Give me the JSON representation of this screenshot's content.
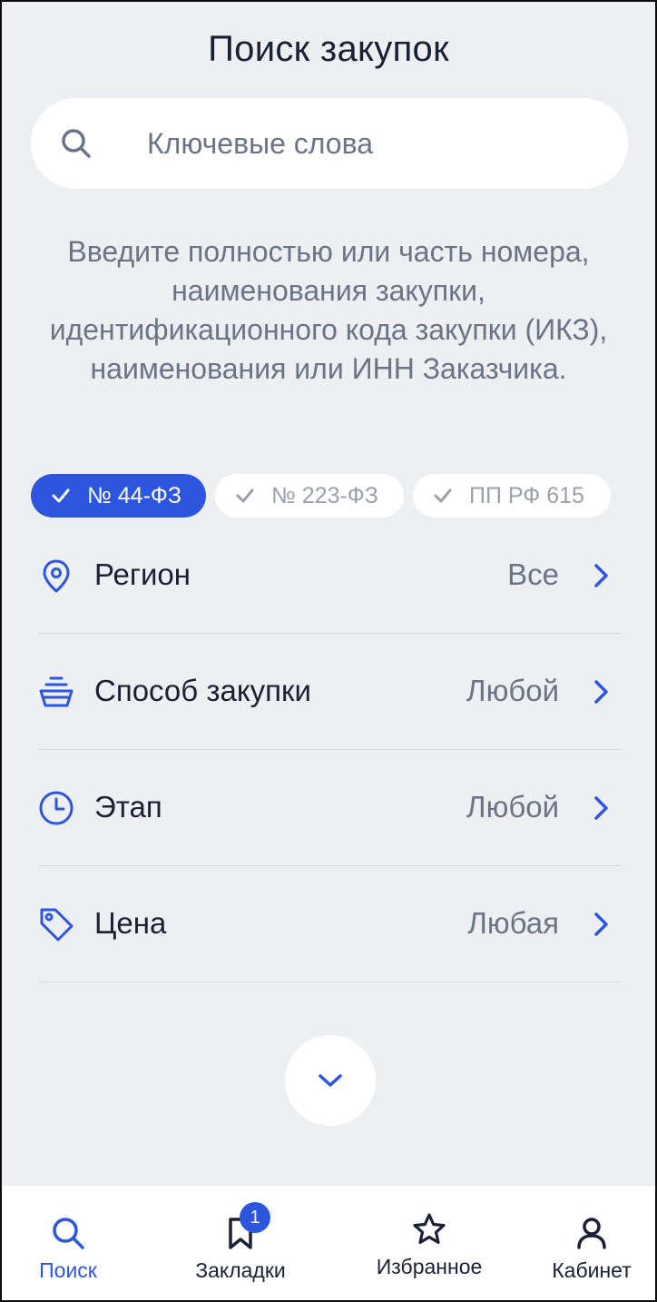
{
  "header": {
    "title": "Поиск закупок"
  },
  "search": {
    "placeholder": "Ключевые слова",
    "value": ""
  },
  "hint": "Введите полностью или часть номера, наименования закупки, идентификационного кода закупки (ИКЗ), наименования или ИНН Заказчика.",
  "chips": [
    {
      "label": "№ 44-ФЗ",
      "selected": true
    },
    {
      "label": "№ 223-ФЗ",
      "selected": false
    },
    {
      "label": "ПП РФ 615",
      "selected": false
    }
  ],
  "filters": [
    {
      "icon": "location-pin-icon",
      "label": "Регион",
      "value": "Все"
    },
    {
      "icon": "auction-stand-icon",
      "label": "Способ закупки",
      "value": "Любой"
    },
    {
      "icon": "clock-icon",
      "label": "Этап",
      "value": "Любой"
    },
    {
      "icon": "price-tag-icon",
      "label": "Цена",
      "value": "Любая"
    }
  ],
  "tabbar": {
    "items": [
      {
        "label": "Поиск",
        "icon": "search-icon",
        "active": true
      },
      {
        "label": "Закладки",
        "icon": "bookmark-icon",
        "badge": "1"
      },
      {
        "label": "Избранное",
        "icon": "star-icon"
      },
      {
        "label": "Кабинет",
        "icon": "user-icon"
      }
    ]
  },
  "colors": {
    "accent": "#2d56e0",
    "background": "#edeff2",
    "text": "#1b2134",
    "muted": "#6b7487"
  }
}
